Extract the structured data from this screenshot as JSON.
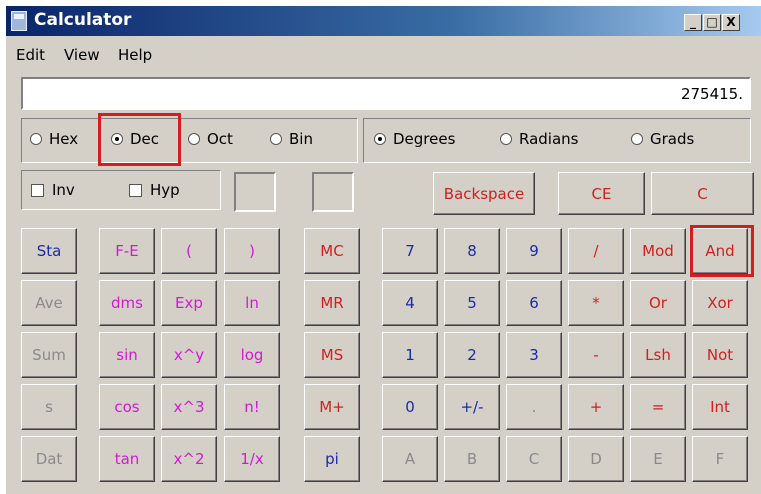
{
  "window": {
    "title": "Calculator",
    "controls": [
      "_",
      "□",
      "X"
    ]
  },
  "menu": [
    "Edit",
    "View",
    "Help"
  ],
  "display": {
    "value": "275415."
  },
  "number_system": {
    "options": [
      "Hex",
      "Dec",
      "Oct",
      "Bin"
    ],
    "selected": "Dec"
  },
  "angle_units": {
    "options": [
      "Degrees",
      "Radians",
      "Grads"
    ],
    "selected": "Degrees"
  },
  "checkboxes": {
    "inv": "Inv",
    "hyp": "Hyp"
  },
  "top_buttons": [
    "Backspace",
    "CE",
    "C"
  ],
  "stat_buttons": [
    "Sta",
    "Ave",
    "Sum",
    "s",
    "Dat"
  ],
  "sci_buttons": [
    [
      "F-E",
      "(",
      ")"
    ],
    [
      "dms",
      "Exp",
      "ln"
    ],
    [
      "sin",
      "x^y",
      "log"
    ],
    [
      "cos",
      "x^3",
      "n!"
    ],
    [
      "tan",
      "x^2",
      "1/x"
    ]
  ],
  "memory_buttons": [
    "MC",
    "MR",
    "MS",
    "M+",
    "pi"
  ],
  "main_buttons": [
    [
      "7",
      "8",
      "9",
      "/",
      "Mod",
      "And"
    ],
    [
      "4",
      "5",
      "6",
      "*",
      "Or",
      "Xor"
    ],
    [
      "1",
      "2",
      "3",
      "-",
      "Lsh",
      "Not"
    ],
    [
      "0",
      "+/-",
      ".",
      "+",
      "=",
      "Int"
    ],
    [
      "A",
      "B",
      "C",
      "D",
      "E",
      "F"
    ]
  ],
  "colors": {
    "blue": "#1a2aa8",
    "magenta": "#d21ad2",
    "red": "#d11f1f",
    "gray": "#8a8a8a",
    "highlight": "#d11f1f"
  }
}
